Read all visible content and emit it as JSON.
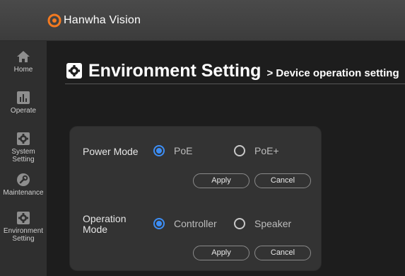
{
  "brand": {
    "name": "Hanwha Vision",
    "accent": "#f47a20"
  },
  "sidebar": {
    "items": [
      {
        "label": "Home",
        "icon": "home-icon"
      },
      {
        "label": "Operate",
        "icon": "chart-icon"
      },
      {
        "label": "System Setting",
        "icon": "gear-icon"
      },
      {
        "label": "Maintenance",
        "icon": "wrench-icon"
      },
      {
        "label_line1": "Environment",
        "label_line2": "Setting",
        "icon": "gear-icon"
      }
    ]
  },
  "header": {
    "title": "Environment Setting",
    "breadcrumb": "> Device operation setting",
    "icon": "gear-icon"
  },
  "power_mode": {
    "label": "Power Mode",
    "options": [
      {
        "label": "PoE",
        "selected": true
      },
      {
        "label": "PoE+",
        "selected": false
      }
    ],
    "apply_label": "Apply",
    "cancel_label": "Cancel"
  },
  "operation_mode": {
    "label_line1": "Operation",
    "label_line2": "Mode",
    "options": [
      {
        "label": "Controller",
        "selected": true
      },
      {
        "label": "Speaker",
        "selected": false
      }
    ],
    "apply_label": "Apply",
    "cancel_label": "Cancel"
  },
  "colors": {
    "radio_selected": "#3d8ef5"
  }
}
